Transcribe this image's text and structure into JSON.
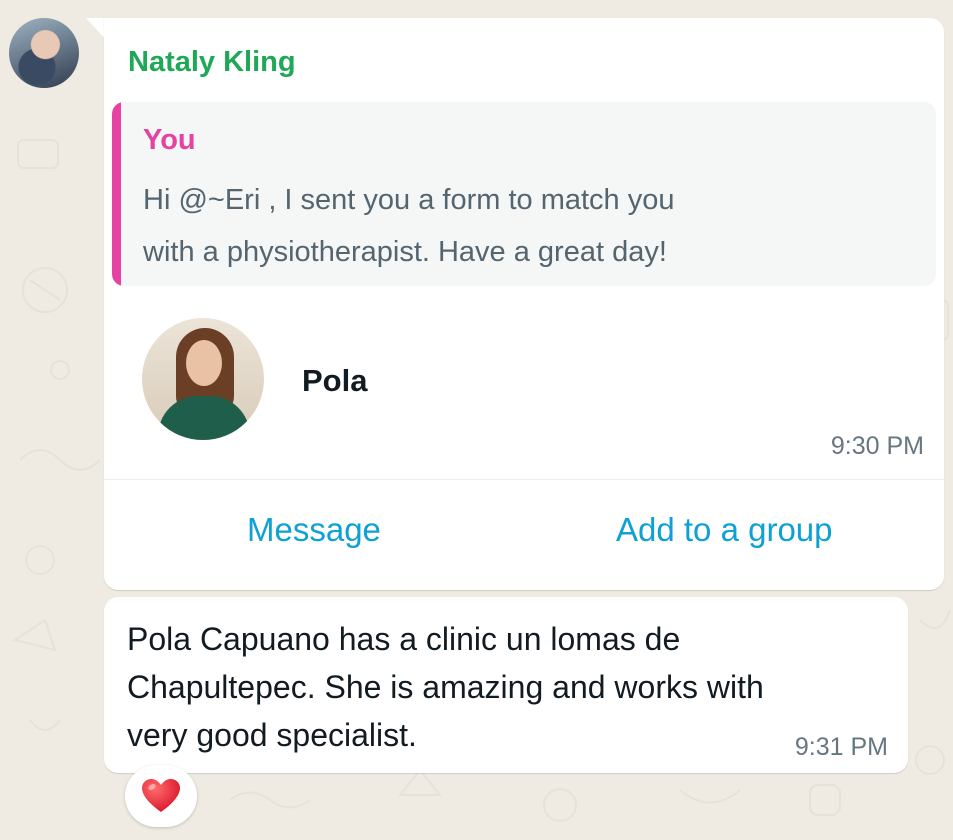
{
  "chat": {
    "sender_name": "Nataly Kling",
    "quoted": {
      "author": "You",
      "line1": "Hi @~Eri , I sent you a form to match you",
      "line2": "with a physiotherapist. Have a great day!"
    },
    "contact_card": {
      "name": "Pola",
      "time": "9:30 PM",
      "message_label": "Message",
      "add_group_label": "Add to a group"
    },
    "message2": {
      "line1": "Pola Capuano has a clinic un lomas de",
      "line2": "Chapultepec. She is amazing and works with",
      "line3": "very good specialist.",
      "time": "9:31 PM"
    },
    "reaction": {
      "emoji": "heart-icon"
    }
  },
  "colors": {
    "background": "#efeae2",
    "sender_name": "#1fa855",
    "quote_author": "#e542a3",
    "action_link": "#0fa0d6",
    "timestamp": "#667781"
  }
}
